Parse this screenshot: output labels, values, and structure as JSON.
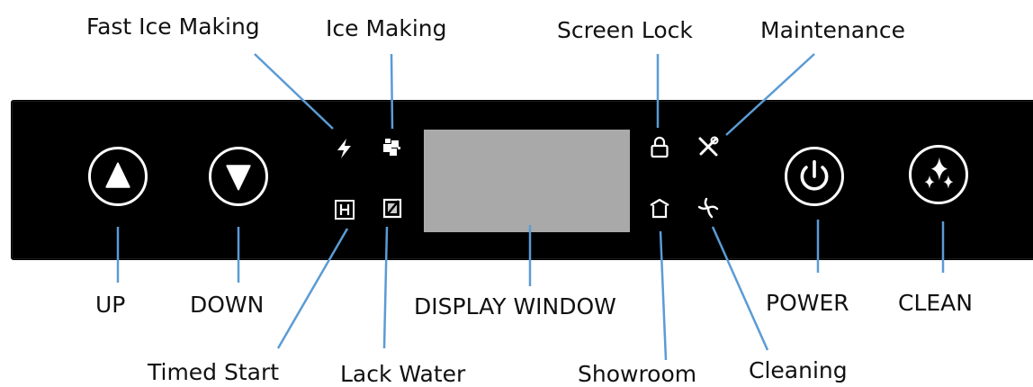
{
  "labels": {
    "fast_ice_making": "Fast Ice Making",
    "ice_making": "Ice Making",
    "screen_lock": "Screen Lock",
    "maintenance": "Maintenance",
    "up": "UP",
    "down": "DOWN",
    "display_window": "DISPLAY WINDOW",
    "power": "POWER",
    "clean": "CLEAN",
    "timed_start": "Timed Start",
    "lack_water": "Lack Water",
    "showroom": "Showroom",
    "cleaning": "Cleaning"
  },
  "icons": {
    "up": "triangle-up-icon",
    "down": "triangle-down-icon",
    "fast_ice_making": "lightning-bolt-icon",
    "ice_making": "ice-cubes-icon",
    "timed_start": "h-box-icon",
    "lack_water": "cup-slash-icon",
    "screen_lock": "padlock-icon",
    "maintenance": "wrench-screwdriver-icon",
    "showroom": "house-icon",
    "cleaning": "pinwheel-icon",
    "power": "power-icon",
    "clean": "sparkle-icon"
  },
  "colors": {
    "panel": "#000000",
    "display": "#a9a9a9",
    "leader_line": "#5b9bd5",
    "icon": "#ffffff",
    "text": "#111111"
  }
}
